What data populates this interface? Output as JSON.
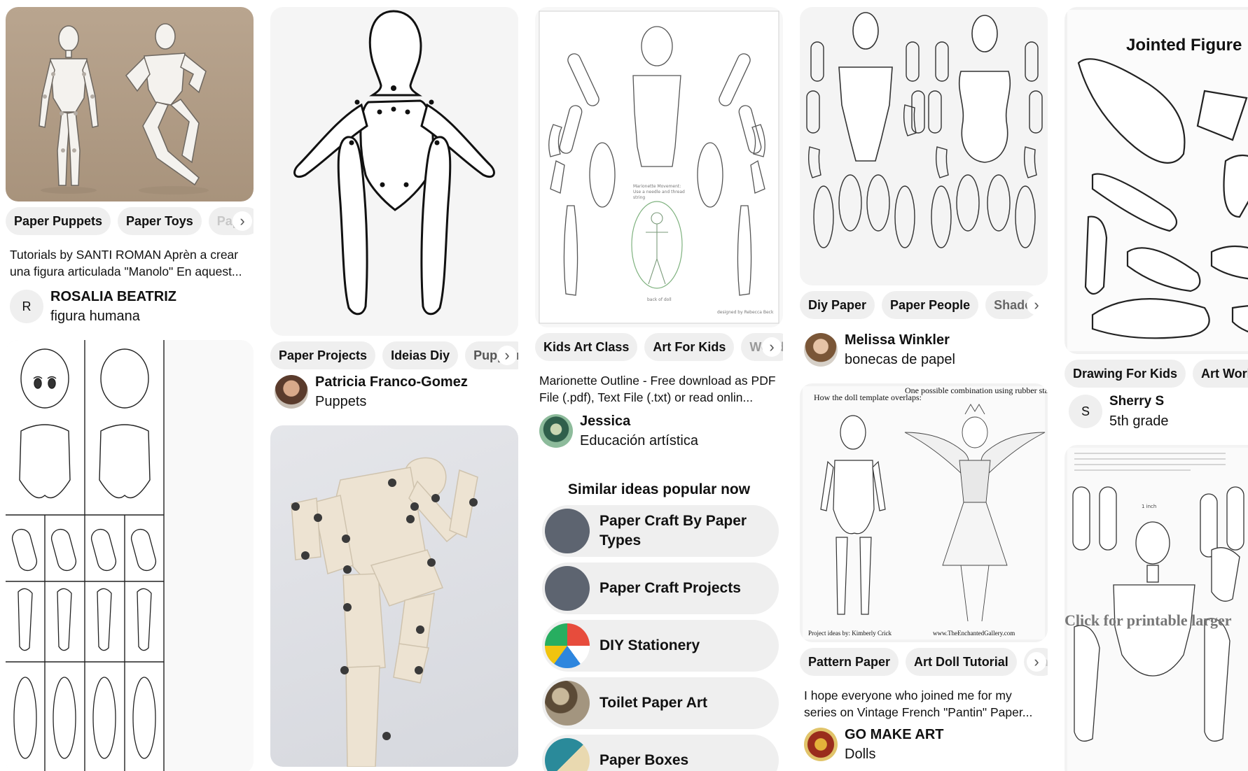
{
  "columns": [
    [
      {
        "kind": "pin",
        "image_alt": "Two articulated figure drawings on a tan background",
        "chips": [
          "Paper Puppets",
          "Paper Toys",
          "Paper A"
        ],
        "description": "Tutorials by SANTI ROMAN Aprèn a crear una figura articulada \"Manolo\" En aquest...",
        "avatar_initial": "R",
        "author": "ROSALIA BEATRIZ",
        "board": "figura humana"
      },
      {
        "kind": "pin",
        "image_alt": "Paper doll template with face, body and jointed limb pieces",
        "chips": []
      }
    ],
    [
      {
        "kind": "pin",
        "image_alt": "Outline of a jointed paper puppet",
        "chips": [
          "Paper Projects",
          "Ideias Diy",
          "Puppetr"
        ],
        "author": "Patricia Franco-Gomez",
        "board": "Puppets"
      },
      {
        "kind": "pin",
        "image_alt": "Cut-out cardboard jointed figure with brass fasteners",
        "chips": []
      }
    ],
    [
      {
        "kind": "pin",
        "image_alt": "Marionette outline pieces",
        "chips": [
          "Kids Art Class",
          "Art For Kids",
          "Woode"
        ],
        "description": "Marionette Outline - Free download as PDF File (.pdf), Text File (.txt) or read onlin...",
        "author": "Jessica",
        "board": "Educación artística"
      }
    ],
    [
      {
        "kind": "pin",
        "image_alt": "Male and female paper doll body parts",
        "chips": [
          "Diy Paper",
          "Paper People",
          "Shadow P"
        ],
        "author": "Melissa Winkler",
        "board": "bonecas de papel"
      },
      {
        "kind": "pin",
        "image_alt": "Doll template overlaps and dressed fairy doll",
        "chips": [
          "Pattern Paper",
          "Art Doll Tutorial",
          "Sh"
        ],
        "description": "I hope everyone who joined me for my series on Vintage French \"Pantin\" Paper...",
        "author": "GO MAKE ART",
        "board": "Dolls"
      }
    ],
    [
      {
        "kind": "pin",
        "image_alt": "Jointed figure worksheet",
        "chips": [
          "Drawing For Kids",
          "Art Works"
        ],
        "avatar_initial": "S",
        "author": "Sherry S",
        "board": "5th grade"
      },
      {
        "kind": "pin",
        "image_alt": "Printable paper doll template",
        "chips": []
      }
    ]
  ],
  "image_text": {
    "doll_overlap_caption": "How the doll template overlaps:",
    "doll_combo_caption": "One possible combination using rubber stamps to dress her up:",
    "doll_credit_left": "Project ideas by: Kimberly Crick",
    "doll_credit_right": "www.TheEnchantedGallery.com",
    "jointed_title": "Jointed Figure",
    "printable_caption": "Click for printable larger",
    "scale_label": "1 inch"
  },
  "similar": {
    "title": "Similar ideas popular now",
    "items": [
      {
        "label": "Paper Craft By Paper Types",
        "thumb": "plain"
      },
      {
        "label": "Paper Craft Projects",
        "thumb": "plain"
      },
      {
        "label": "DIY Stationery",
        "thumb": "paint"
      },
      {
        "label": "Toilet Paper Art",
        "thumb": "rolls"
      },
      {
        "label": "Paper Boxes",
        "thumb": "boxes"
      }
    ]
  },
  "colors": {
    "chip_bg": "#efefef",
    "thumb_gray": "#5d6470",
    "tan_background": "#b29d86",
    "cardboard": "#ede3d2"
  }
}
